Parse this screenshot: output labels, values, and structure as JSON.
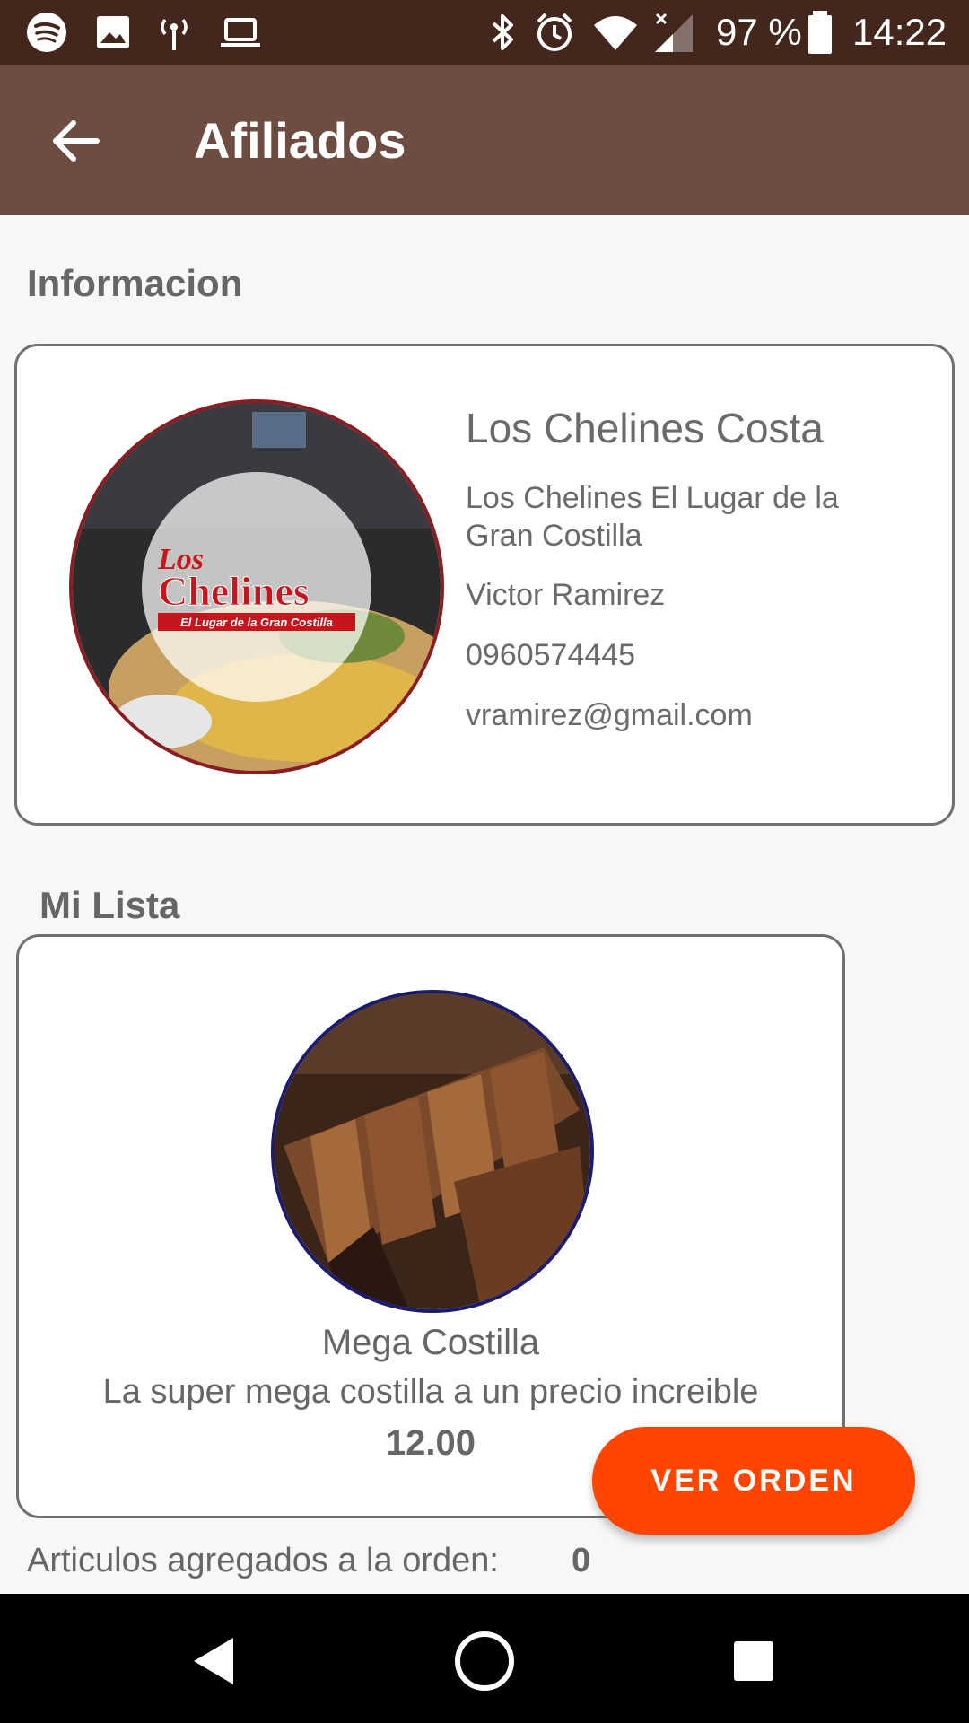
{
  "status_bar": {
    "battery": "97 %",
    "time": "14:22",
    "icons": [
      "spotify-icon",
      "image-icon",
      "hotspot-icon",
      "laptop-icon",
      "bluetooth-icon",
      "alarm-icon",
      "wifi-icon",
      "signal-icon",
      "battery-icon"
    ]
  },
  "app_bar": {
    "title": "Afiliados",
    "back_icon": "arrow-back-icon"
  },
  "info_section": {
    "heading": "Informacion",
    "name": "Los Chelines Costa",
    "description": "Los Chelines El Lugar de la Gran Costilla",
    "owner": "Victor Ramirez",
    "phone": "0960574445",
    "email": "vramirez@gmail.com",
    "logo": {
      "line1": "Los",
      "line2": "Chelines",
      "tagline": "El Lugar de la Gran Costilla"
    }
  },
  "list_section": {
    "heading": "Mi Lista",
    "product": {
      "name": "Mega Costilla",
      "description": "La super mega costilla a un precio increible",
      "price": "12.00"
    }
  },
  "order_button": {
    "label": "VER ORDEN"
  },
  "order_counter": {
    "label": "Articulos agregados a la orden:",
    "value": "0"
  },
  "colors": {
    "status_bar": "#43261c",
    "app_bar": "#6d4c41",
    "accent": "#ff4500",
    "background": "#f7f7f7"
  },
  "nav_bar": {
    "icons": [
      "back-triangle-icon",
      "home-circle-icon",
      "recents-square-icon"
    ]
  }
}
